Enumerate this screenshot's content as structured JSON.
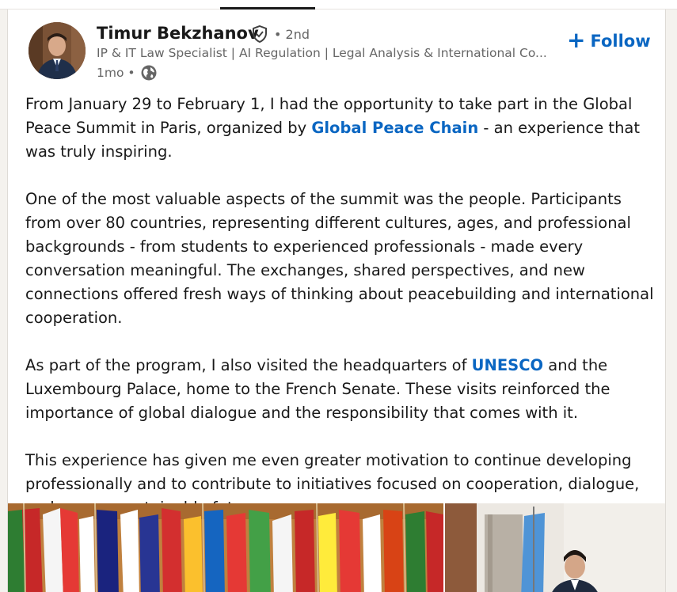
{
  "post": {
    "author": {
      "name": "Timur Bekzhanov",
      "verified_icon": "verified-shield-icon",
      "degree": "• 2nd",
      "headline": "IP & IT Law Specialist | AI Regulation | Legal Analysis & International Co...",
      "time": "1mo •",
      "visibility_icon": "globe-icon"
    },
    "follow_label": "Follow",
    "follow_icon": "+",
    "paragraphs": [
      {
        "before": "From January 29 to February 1, I had the opportunity to take part in the Global Peace Summit in Paris, organized by ",
        "mention": "Global Peace Chain",
        "after": " - an experience that was truly inspiring."
      },
      {
        "text": "One of the most valuable aspects of the summit was the people. Participants from over 80 countries, representing different cultures, ages, and professional backgrounds - from students to experienced professionals - made every conversation meaningful. The exchanges, shared perspectives, and new connections offered fresh ways of thinking about peacebuilding and international cooperation."
      },
      {
        "before": "As part of the program, I also visited the headquarters of ",
        "mention": "UNESCO",
        "after": " and the Luxembourg Palace, home to the French Senate. These visits reinforced the importance of global dialogue and the responsibility that comes with it."
      },
      {
        "text": "This experience has given me even greater motivation to continue developing professionally and to contribute to initiatives focused on cooperation, dialogue, and a more sustainable future."
      }
    ]
  },
  "colors": {
    "link": "#0a66c2",
    "secondary_text": "#666666",
    "background": "#f4f2ee"
  }
}
